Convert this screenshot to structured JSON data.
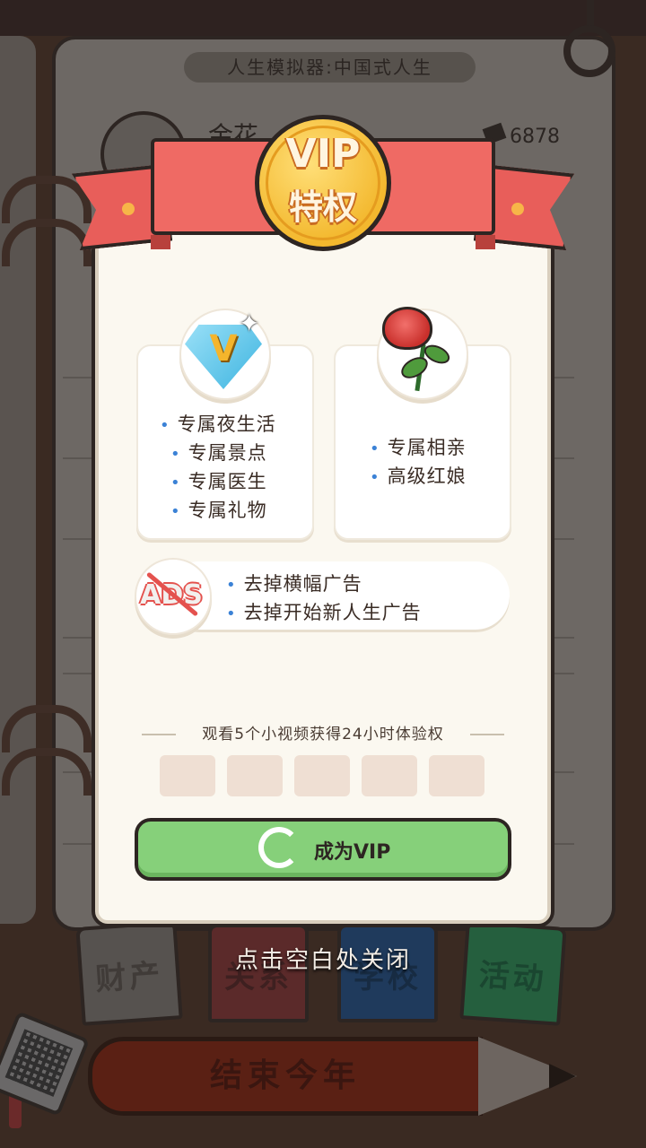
{
  "background": {
    "app_title": "人生模拟器:中国式人生",
    "player_name": "金花",
    "money": "6878",
    "tabs": [
      "财产",
      "关系",
      "学校",
      "活动"
    ],
    "end_year_label": "结束今年"
  },
  "popup": {
    "badge_main": "VIP",
    "badge_sub": "特权",
    "card1": {
      "icon": "diamond-v-icon",
      "badge_letter": "V",
      "items": [
        "专属夜生活",
        "专属景点",
        "专属医生",
        "专属礼物"
      ]
    },
    "card2": {
      "icon": "rose-icon",
      "items": [
        "专属相亲",
        "高级红娘"
      ]
    },
    "ads_card": {
      "icon_text": "ADS",
      "items": [
        "去掉横幅广告",
        "去掉开始新人生广告"
      ]
    },
    "watch_text": "观看5个小视频获得24小时体验权",
    "progress": {
      "watched": 0,
      "total": 5
    },
    "button_label": "成为VIP",
    "close_hint": "点击空白处关闭"
  },
  "colors": {
    "ribbon": "#ef6a64",
    "coin": "#f3b82e",
    "button": "#86d07a",
    "bullet": "#3b82d6"
  }
}
